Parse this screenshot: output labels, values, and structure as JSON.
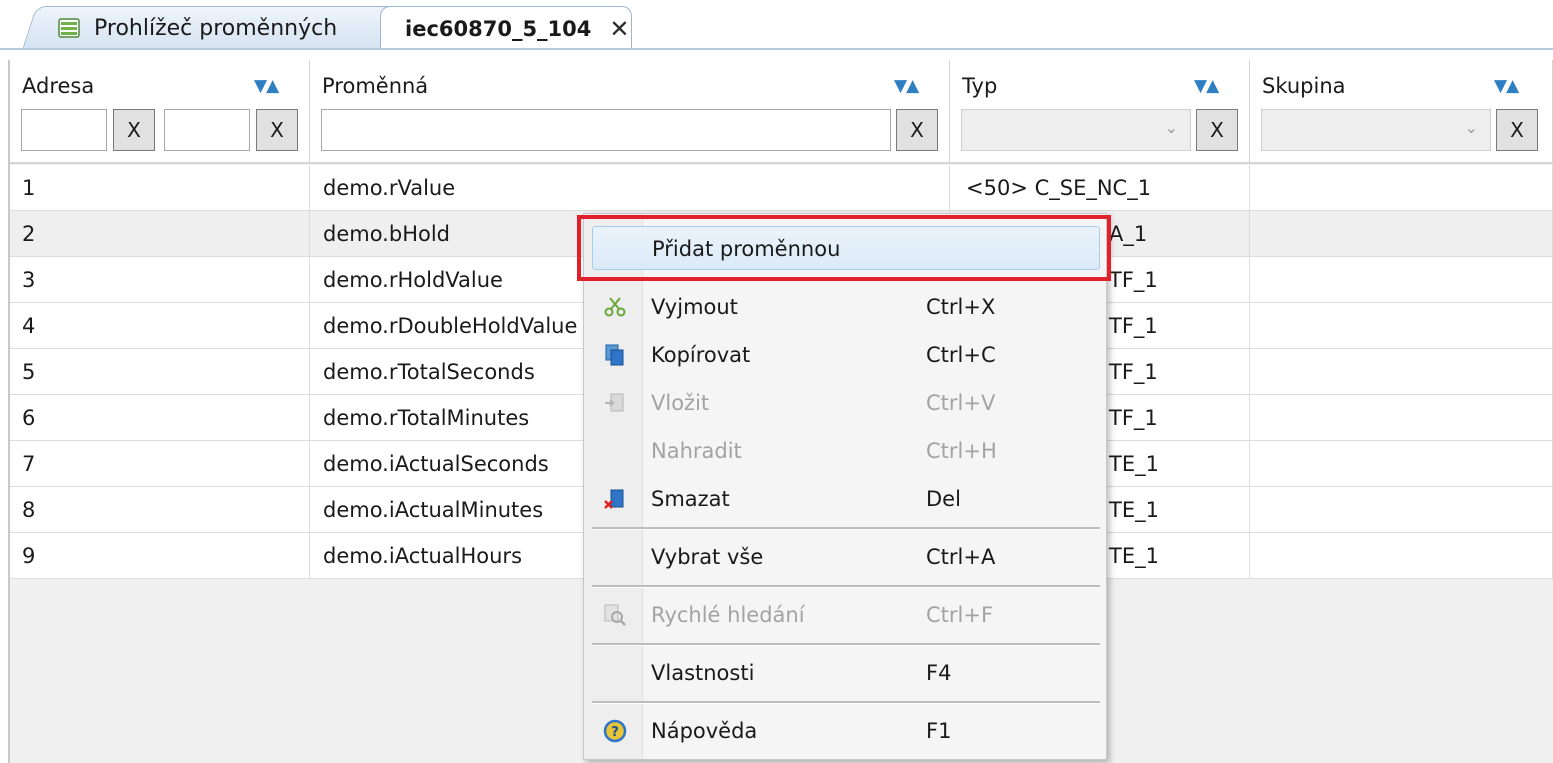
{
  "tabs": [
    {
      "label": "Prohlížeč proměnných",
      "active": false
    },
    {
      "label": "iec60870_5_104",
      "active": true
    }
  ],
  "colors": {
    "accent": "#2f7fc3",
    "highlight": "#e0202a",
    "selected_row": "#efefef"
  },
  "columns": [
    {
      "label": "Adresa"
    },
    {
      "label": "Proměnná"
    },
    {
      "label": "Typ"
    },
    {
      "label": "Skupina"
    }
  ],
  "filters": {
    "clear_label": "X",
    "sort_glyph": "▼▲",
    "chevron_glyph": "⌄"
  },
  "rows": [
    {
      "address": "1",
      "variable": "demo.rValue",
      "type": "<50> C_SE_NC_1",
      "group": ""
    },
    {
      "address": "2",
      "variable": "demo.bHold",
      "type": "A_1",
      "group": ""
    },
    {
      "address": "3",
      "variable": "demo.rHoldValue",
      "type": "TF_1",
      "group": ""
    },
    {
      "address": "4",
      "variable": "demo.rDoubleHoldValue",
      "type": "TF_1",
      "group": ""
    },
    {
      "address": "5",
      "variable": "demo.rTotalSeconds",
      "type": "TF_1",
      "group": ""
    },
    {
      "address": "6",
      "variable": "demo.rTotalMinutes",
      "type": "TF_1",
      "group": ""
    },
    {
      "address": "7",
      "variable": "demo.iActualSeconds",
      "type": "TE_1",
      "group": ""
    },
    {
      "address": "8",
      "variable": "demo.iActualMinutes",
      "type": "TE_1",
      "group": ""
    },
    {
      "address": "9",
      "variable": "demo.iActualHours",
      "type": "TE_1",
      "group": ""
    }
  ],
  "context_menu": {
    "items": [
      {
        "label": "Přidat proměnnou",
        "shortcut": "",
        "icon": "",
        "disabled": false,
        "hover": true
      },
      {
        "label": "Vyjmout",
        "shortcut": "Ctrl+X",
        "icon": "scissors-icon",
        "disabled": false
      },
      {
        "label": "Kopírovat",
        "shortcut": "Ctrl+C",
        "icon": "copy-icon",
        "disabled": false
      },
      {
        "label": "Vložit",
        "shortcut": "Ctrl+V",
        "icon": "paste-icon",
        "disabled": true
      },
      {
        "label": "Nahradit",
        "shortcut": "Ctrl+H",
        "icon": "",
        "disabled": true
      },
      {
        "label": "Smazat",
        "shortcut": "Del",
        "icon": "delete-icon",
        "disabled": false
      },
      {
        "label": "Vybrat vše",
        "shortcut": "Ctrl+A",
        "icon": "",
        "disabled": false
      },
      {
        "label": "Rychlé hledání",
        "shortcut": "Ctrl+F",
        "icon": "quick-search-icon",
        "disabled": true
      },
      {
        "label": "Vlastnosti",
        "shortcut": "F4",
        "icon": "",
        "disabled": false
      },
      {
        "label": "Nápověda",
        "shortcut": "F1",
        "icon": "help-icon",
        "disabled": false
      }
    ]
  }
}
